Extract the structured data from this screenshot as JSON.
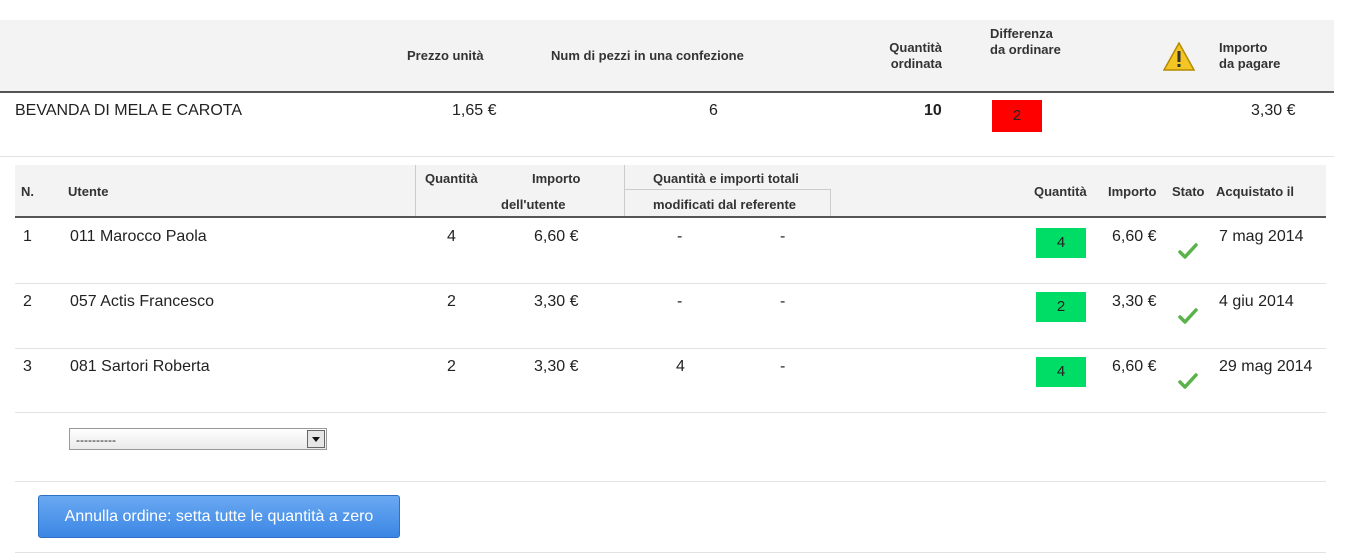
{
  "header": {
    "prezzo_unita": "Prezzo unità",
    "num_pezzi": "Num di pezzi in una confezione",
    "quantita_line1": "Quantità",
    "quantita_line2": "ordinata",
    "differenza_line1": "Differenza",
    "differenza_line2": "da ordinare",
    "importo_line1": "Importo",
    "importo_line2": "da pagare"
  },
  "product": {
    "name": "BEVANDA DI MELA E CAROTA",
    "price": "1,65 €",
    "pieces": "6",
    "quantity": "10",
    "difference": "2",
    "amount": "3,30 €",
    "difference_color": "#ff0000"
  },
  "subheader": {
    "n": "N.",
    "utente": "Utente",
    "quantita": "Quantità",
    "importo": "Importo",
    "dellutente": "dell'utente",
    "totali_line1": "Quantità e importi totali",
    "totali_line2": "modificati dal referente",
    "quantita2": "Quantità",
    "importo2": "Importo",
    "stato": "Stato",
    "acquistato": "Acquistato il"
  },
  "rows": [
    {
      "n": "1",
      "user": "011 Marocco Paola",
      "qty": "4",
      "amount": "6,60 €",
      "mod_qty": "-",
      "mod_amount": "-",
      "final_qty": "4",
      "final_amount": "6,60 €",
      "status": "check-icon",
      "date": "7 mag 2014"
    },
    {
      "n": "2",
      "user": "057 Actis Francesco",
      "qty": "2",
      "amount": "3,30 €",
      "mod_qty": "-",
      "mod_amount": "-",
      "final_qty": "2",
      "final_amount": "3,30 €",
      "status": "check-icon",
      "date": "4 giu 2014"
    },
    {
      "n": "3",
      "user": "081 Sartori Roberta",
      "qty": "2",
      "amount": "3,30 €",
      "mod_qty": "4",
      "mod_amount": "-",
      "final_qty": "4",
      "final_amount": "6,60 €",
      "status": "check-icon",
      "date": "29 mag 2014"
    }
  ],
  "select": {
    "value": "----------"
  },
  "button": {
    "label": "Annulla ordine: setta tutte le quantità a zero"
  },
  "colors": {
    "qty_box": "#00dd66",
    "button": "#3b86e4"
  }
}
